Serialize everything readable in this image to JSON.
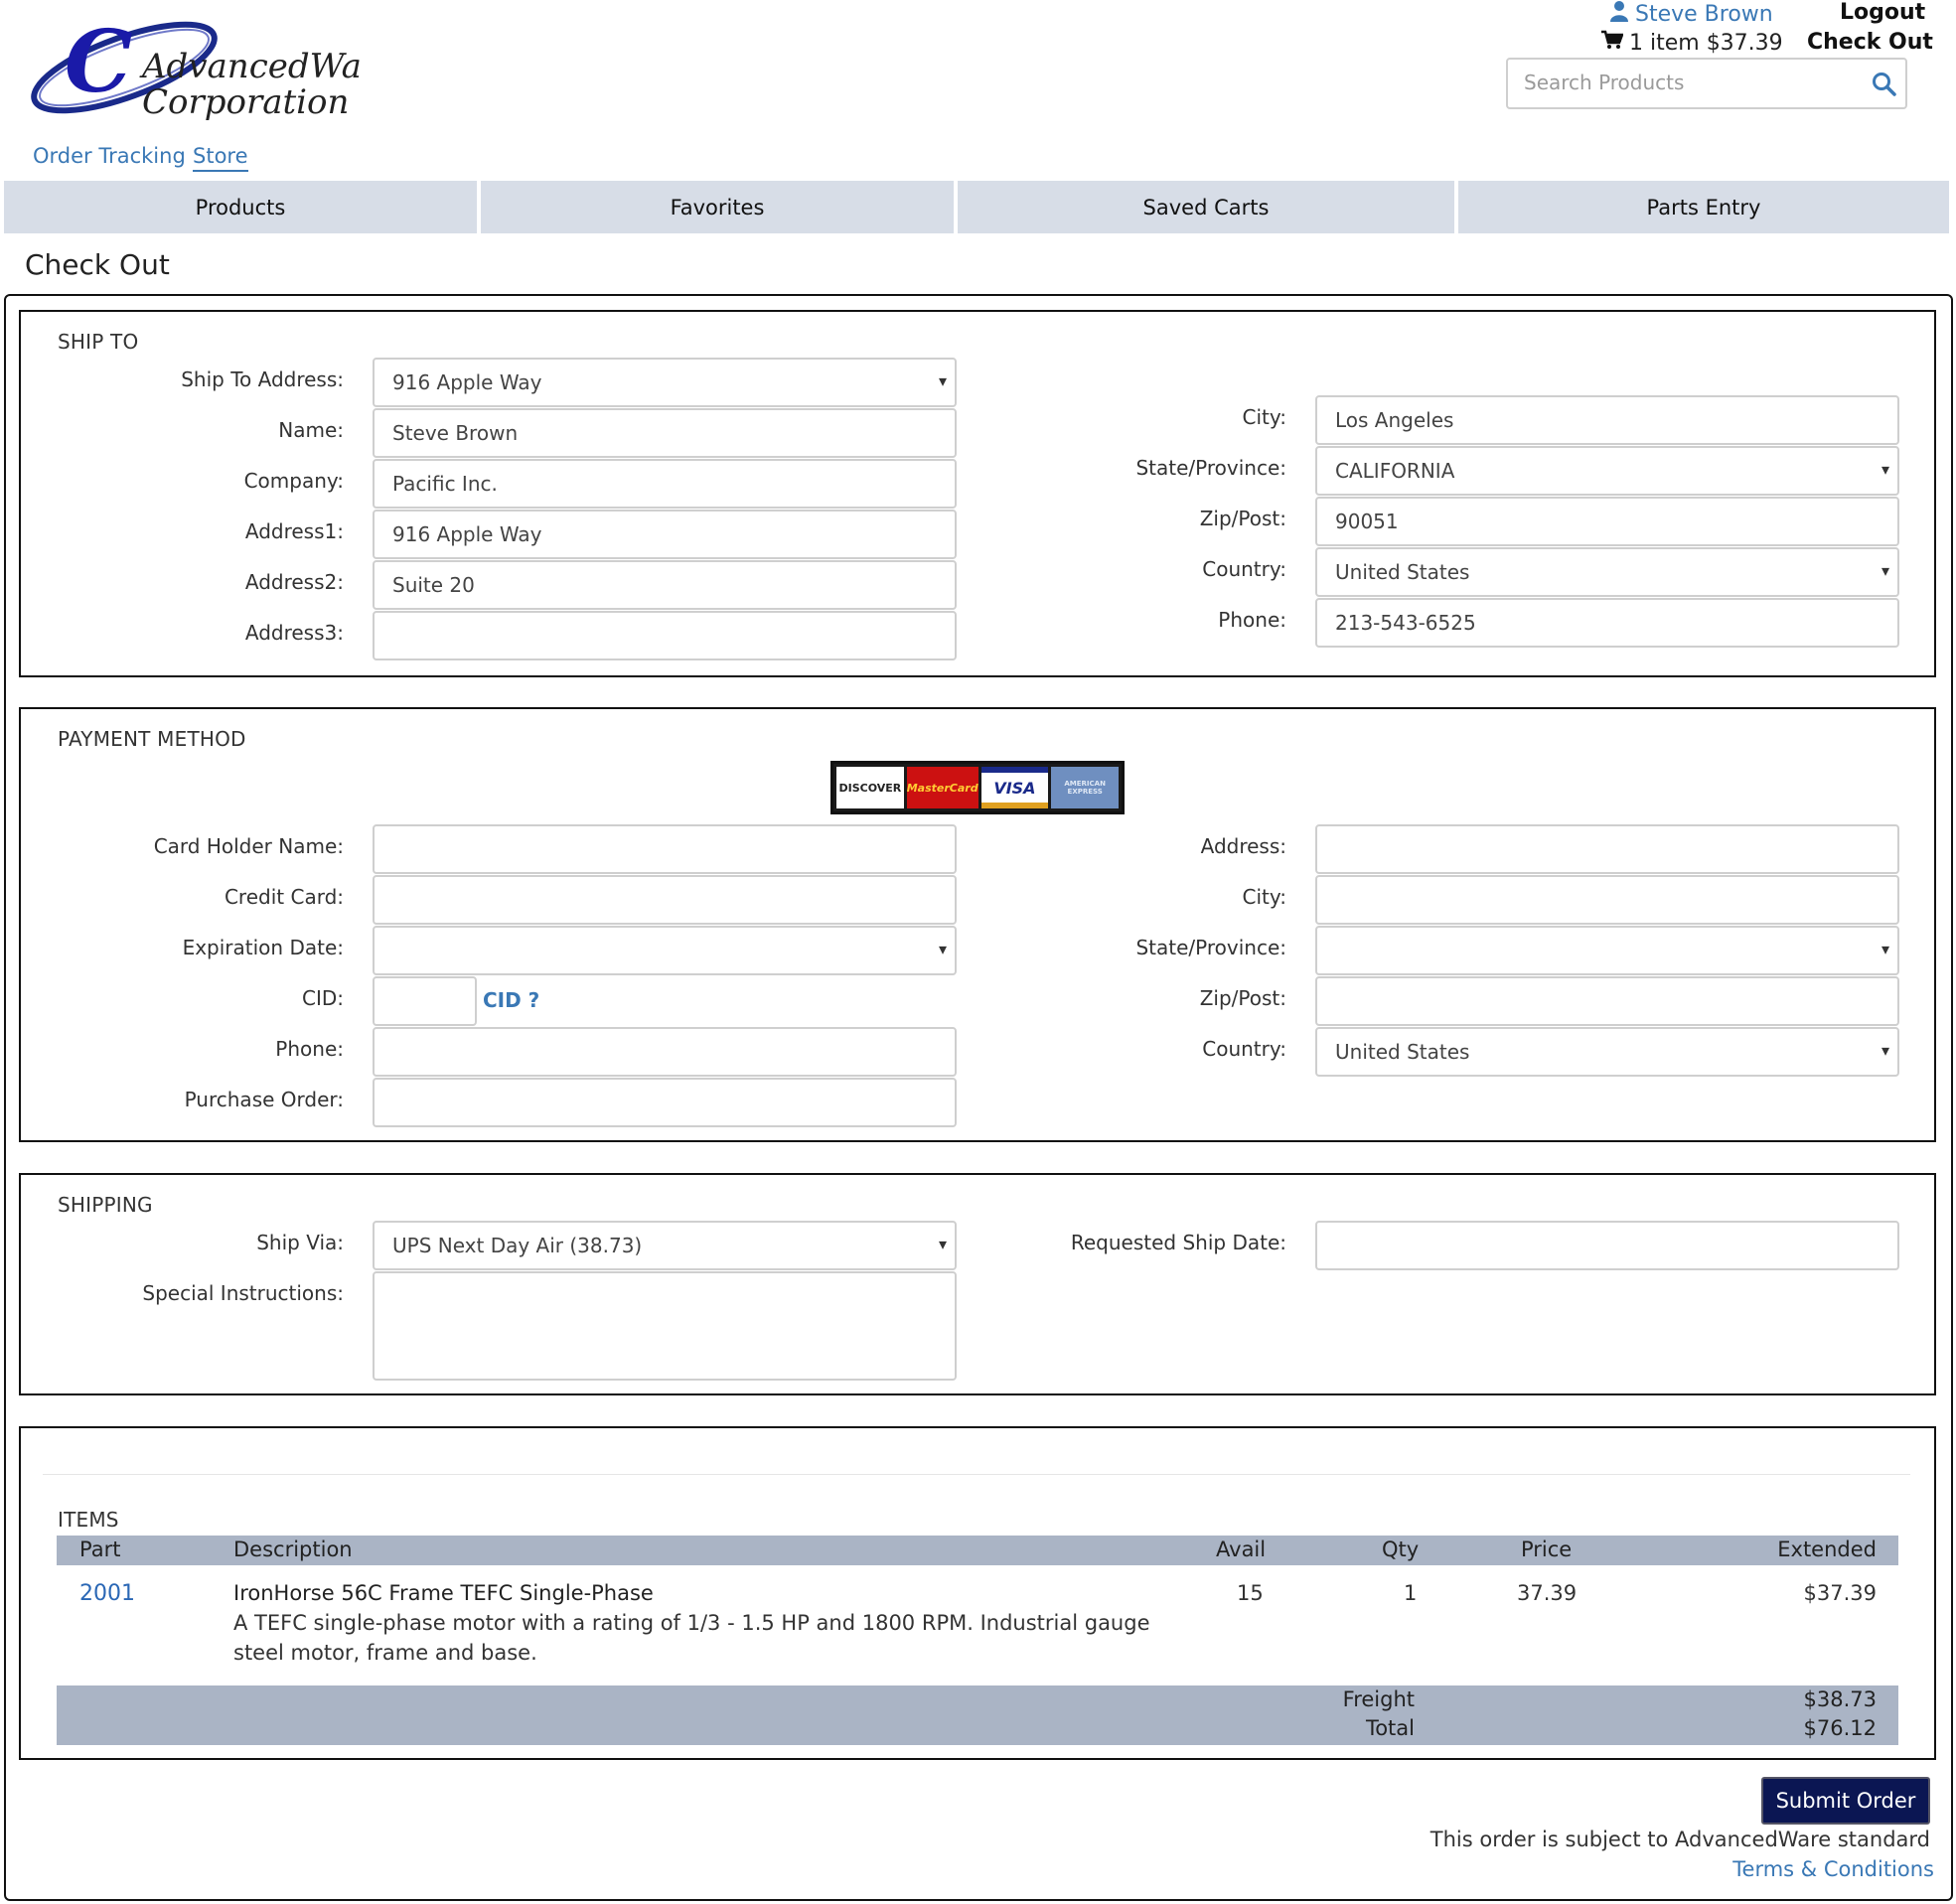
{
  "header": {
    "logo_text_line1": "AdvancedWare",
    "logo_text_line2": "Corporation",
    "user_name": "Steve Brown",
    "logout_label": "Logout",
    "cart_summary": "1 item $37.39",
    "checkout_label": "Check Out",
    "search_placeholder": "Search Products",
    "sublinks": [
      "Order Tracking",
      "Store"
    ]
  },
  "nav": {
    "tabs": [
      "Products",
      "Favorites",
      "Saved Carts",
      "Parts Entry"
    ]
  },
  "page_title": "Check Out",
  "ship_to": {
    "title": "SHIP TO",
    "labels": {
      "ship_to_address": "Ship To Address:",
      "name": "Name:",
      "company": "Company:",
      "address1": "Address1:",
      "address2": "Address2:",
      "address3": "Address3:",
      "city": "City:",
      "state": "State/Province:",
      "zip": "Zip/Post:",
      "country": "Country:",
      "phone": "Phone:"
    },
    "values": {
      "ship_to_address": "916 Apple Way",
      "name": "Steve Brown",
      "company": "Pacific Inc.",
      "address1": "916 Apple Way",
      "address2": "Suite 20",
      "address3": "",
      "city": "Los Angeles",
      "state": "CALIFORNIA",
      "zip": "90051",
      "country": "United States",
      "phone": "213-543-6525"
    }
  },
  "payment": {
    "title": "PAYMENT METHOD",
    "card_logos": [
      "DISCOVER",
      "MasterCard",
      "VISA",
      "AMERICAN EXPRESS"
    ],
    "labels": {
      "card_holder": "Card Holder Name:",
      "credit_card": "Credit Card:",
      "expiration": "Expiration Date:",
      "cid": "CID:",
      "phone": "Phone:",
      "purchase_order": "Purchase Order:",
      "address": "Address:",
      "city": "City:",
      "state": "State/Province:",
      "zip": "Zip/Post:",
      "country": "Country:"
    },
    "cid_help": "CID ?",
    "values": {
      "card_holder": "",
      "credit_card": "",
      "expiration": "",
      "cid": "",
      "phone": "",
      "purchase_order": "",
      "address": "",
      "city": "",
      "state": "",
      "zip": "",
      "country": "United States"
    }
  },
  "shipping": {
    "title": "SHIPPING",
    "labels": {
      "ship_via": "Ship Via:",
      "instructions": "Special Instructions:",
      "requested_date": "Requested Ship Date:"
    },
    "values": {
      "ship_via": "UPS Next Day Air (38.73)",
      "instructions": "",
      "requested_date": ""
    }
  },
  "items": {
    "title": "ITEMS",
    "columns": [
      "Part",
      "Description",
      "Avail",
      "Qty",
      "Price",
      "Extended"
    ],
    "rows": [
      {
        "part": "2001",
        "name": "IronHorse 56C Frame TEFC Single-Phase",
        "description_line1": "A TEFC single-phase motor with a rating of 1/3 - 1.5 HP and 1800 RPM. Industrial gauge",
        "description_line2": "steel motor, frame and base.",
        "avail": "15",
        "qty": "1",
        "price": "37.39",
        "extended": "$37.39"
      }
    ],
    "freight_label": "Freight",
    "freight_value": "$38.73",
    "total_label": "Total",
    "total_value": "$76.12"
  },
  "footer": {
    "submit_label": "Submit Order",
    "terms_text": "This order is subject to AdvancedWare standard",
    "terms_link": "Terms & Conditions"
  },
  "colors": {
    "link": "#3a78b5",
    "nav_bg": "#d7dde7",
    "table_header": "#aab4c5",
    "submit_bg": "#0b1653"
  }
}
